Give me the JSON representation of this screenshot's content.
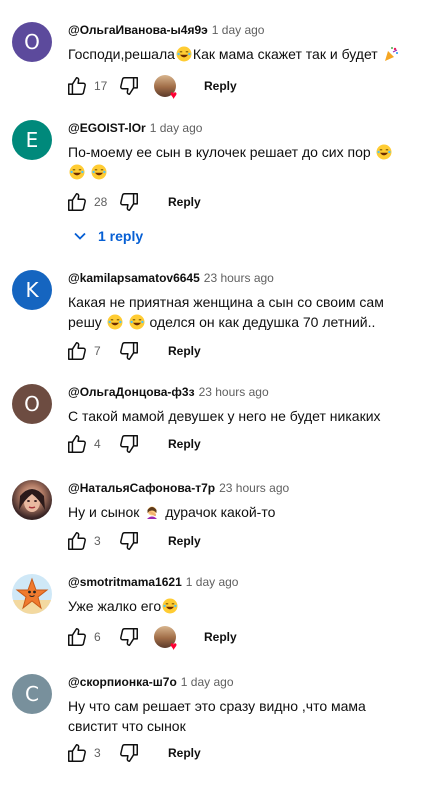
{
  "colors": {
    "avatar_o1": "#5c4a9c",
    "avatar_e": "#00897b",
    "avatar_k": "#1565c0",
    "avatar_o2": "#6d4c41",
    "avatar_c": "#78909c",
    "link_blue": "#065fd4"
  },
  "comments": [
    {
      "avatar_letter": "О",
      "author": "@ОльгаИванова-ы4я9э",
      "time": "1 day ago",
      "text_a": "Господи,решала",
      "text_b": "Как мама скажет так и будет",
      "likes": "17",
      "reply": "Reply",
      "creator_heart": true
    },
    {
      "avatar_letter": "E",
      "author": "@EGOIST-lOr",
      "time": "1 day ago",
      "text_a": "По-моему ее сын в кулочек решает до сих пор",
      "likes": "28",
      "reply": "Reply",
      "replies_label": "1 reply"
    },
    {
      "avatar_letter": "K",
      "author": "@kamilapsamatov6645",
      "time": "23 hours ago",
      "text_a": "Какая не приятная женщина а сын со своим сам",
      "text_b": "решу",
      "text_c": "оделся он как дедушка 70 летний..",
      "likes": "7",
      "reply": "Reply"
    },
    {
      "avatar_letter": "О",
      "author": "@ОльгаДонцова-ф3з",
      "time": "23 hours ago",
      "text_a": "С такой мамой девушек у него не будет никаких",
      "likes": "4",
      "reply": "Reply"
    },
    {
      "author": "@НатальяСафонова-т7р",
      "time": "23 hours ago",
      "text_a": "Ну и сынок",
      "text_b": "дурачок какой-то",
      "likes": "3",
      "reply": "Reply"
    },
    {
      "author": "@smotritmama1621",
      "time": "1 day ago",
      "text_a": "Уже жалко его",
      "likes": "6",
      "reply": "Reply",
      "creator_heart": true
    },
    {
      "avatar_letter": "С",
      "author": "@скорпионка-ш7о",
      "time": "1 day ago",
      "text_a": "Ну что сам решает это сразу видно ,что мама",
      "text_b": "свистит что сынок",
      "likes": "3",
      "reply": "Reply"
    }
  ]
}
